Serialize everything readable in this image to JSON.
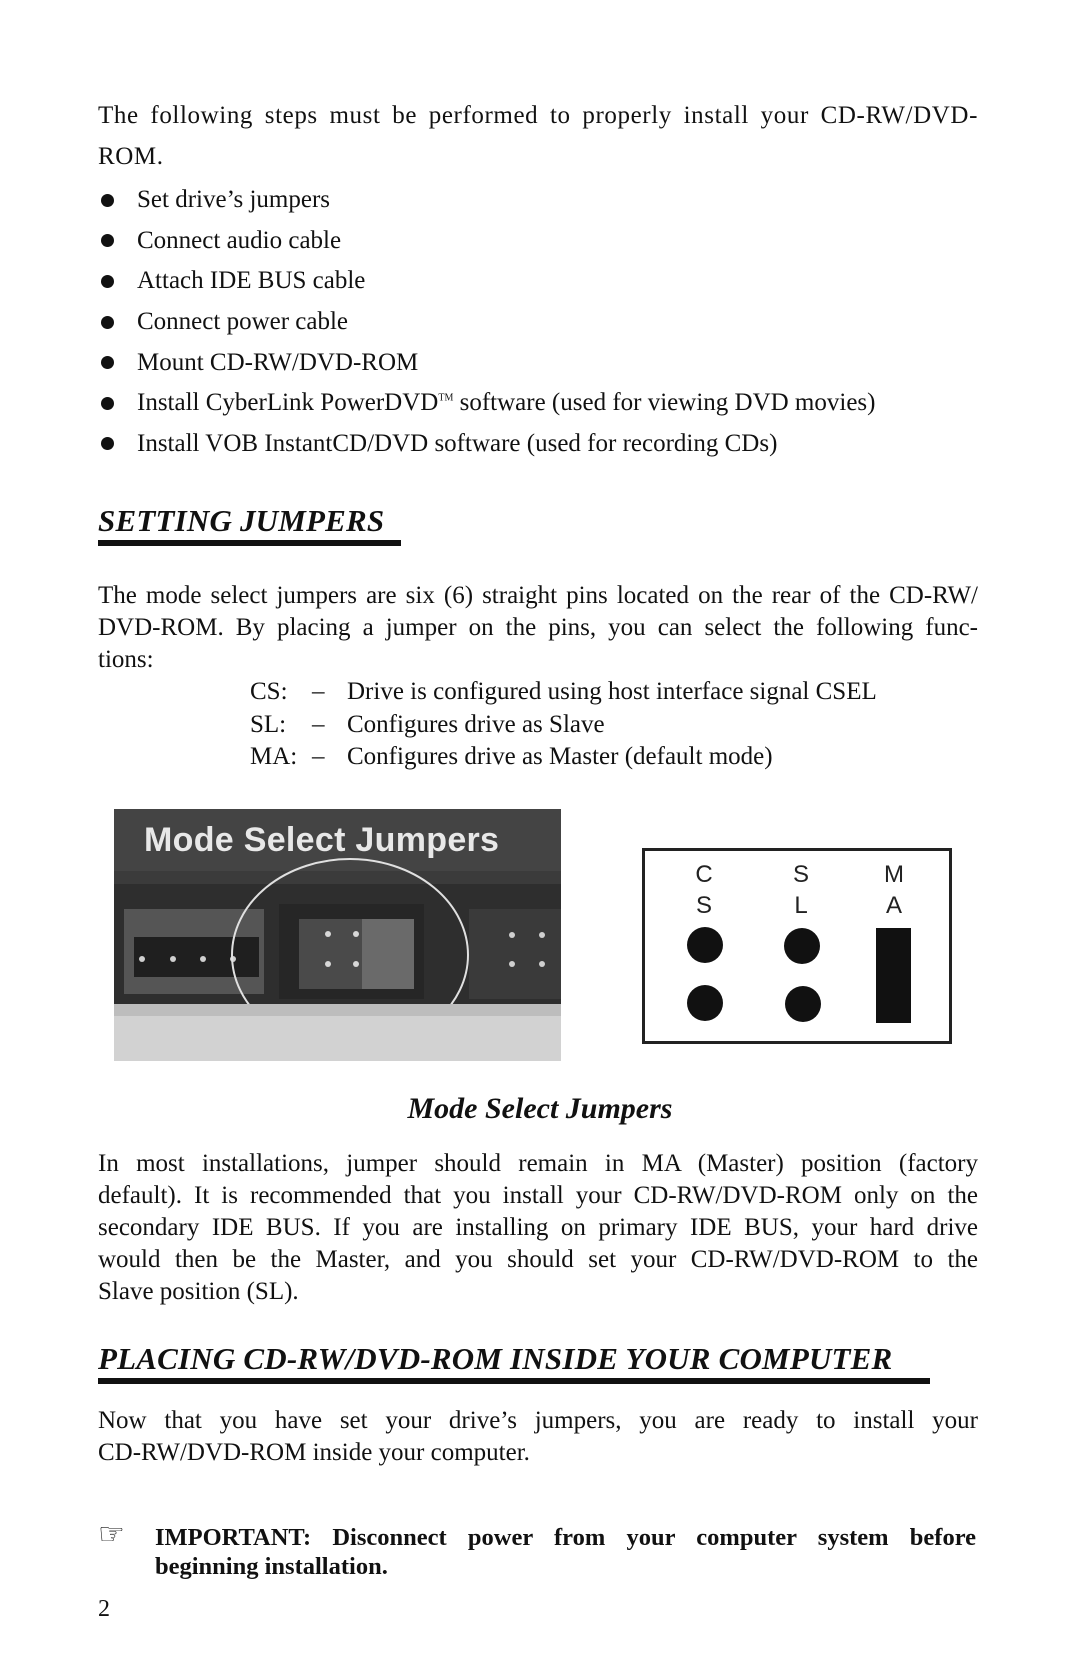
{
  "intro": {
    "line1": "The following steps must be performed to properly install your CD-RW/DVD-",
    "line2": "ROM."
  },
  "steps": [
    {
      "text": "Set drive’s jumpers"
    },
    {
      "text": "Connect audio cable"
    },
    {
      "text": "Attach IDE BUS cable"
    },
    {
      "text": "Connect power cable"
    },
    {
      "text": "Mount CD-RW/DVD-ROM"
    },
    {
      "text": "Install CyberLink PowerDVD",
      "superscript": "TM",
      "text_after": " software (used for viewing DVD movies)"
    },
    {
      "text": "Install VOB InstantCD/DVD software (used for recording CDs)"
    }
  ],
  "section1": {
    "heading": "SETTING JUMPERS",
    "paragraph_lines": [
      "The mode select jumpers are six (6) straight pins located on the rear of the CD-RW/",
      "DVD-ROM. By placing a jumper on the pins, you can select the following func-",
      "tions:"
    ],
    "definitions": [
      {
        "term": "CS:",
        "dash": "–",
        "desc": "Drive is configured using host interface signal CSEL"
      },
      {
        "term": "SL:",
        "dash": "–",
        "desc": "Configures drive as Slave"
      },
      {
        "term": "MA:",
        "dash": "–",
        "desc": "Configures drive as Master (default mode)"
      }
    ],
    "photo_title": "Mode Select Jumpers",
    "diagram": {
      "columns": [
        {
          "top": "C",
          "bottom": "S"
        },
        {
          "top": "S",
          "bottom": "L"
        },
        {
          "top": "M",
          "bottom": "A"
        }
      ],
      "jumper_position": "MA"
    },
    "caption": "Mode Select Jumpers",
    "paragraph2_lines": [
      "In most installations, jumper should remain in MA (Master) position (factory",
      "default). It is recommended that you install your CD-RW/DVD-ROM only on the",
      "secondary IDE BUS. If you are installing on primary IDE BUS, your hard drive",
      "would then be the Master, and you should set your CD-RW/DVD-ROM to the",
      "Slave position (SL)."
    ]
  },
  "section2": {
    "heading": "PLACING CD-RW/DVD-ROM INSIDE YOUR COMPUTER",
    "paragraph_lines": [
      "Now that you have set your drive’s  jumpers, you are ready to install your",
      "CD-RW/DVD-ROM inside your computer."
    ]
  },
  "important": {
    "icon": "☞",
    "text": "IMPORTANT: Disconnect power from your computer system before beginning installation."
  },
  "page_number": "2"
}
